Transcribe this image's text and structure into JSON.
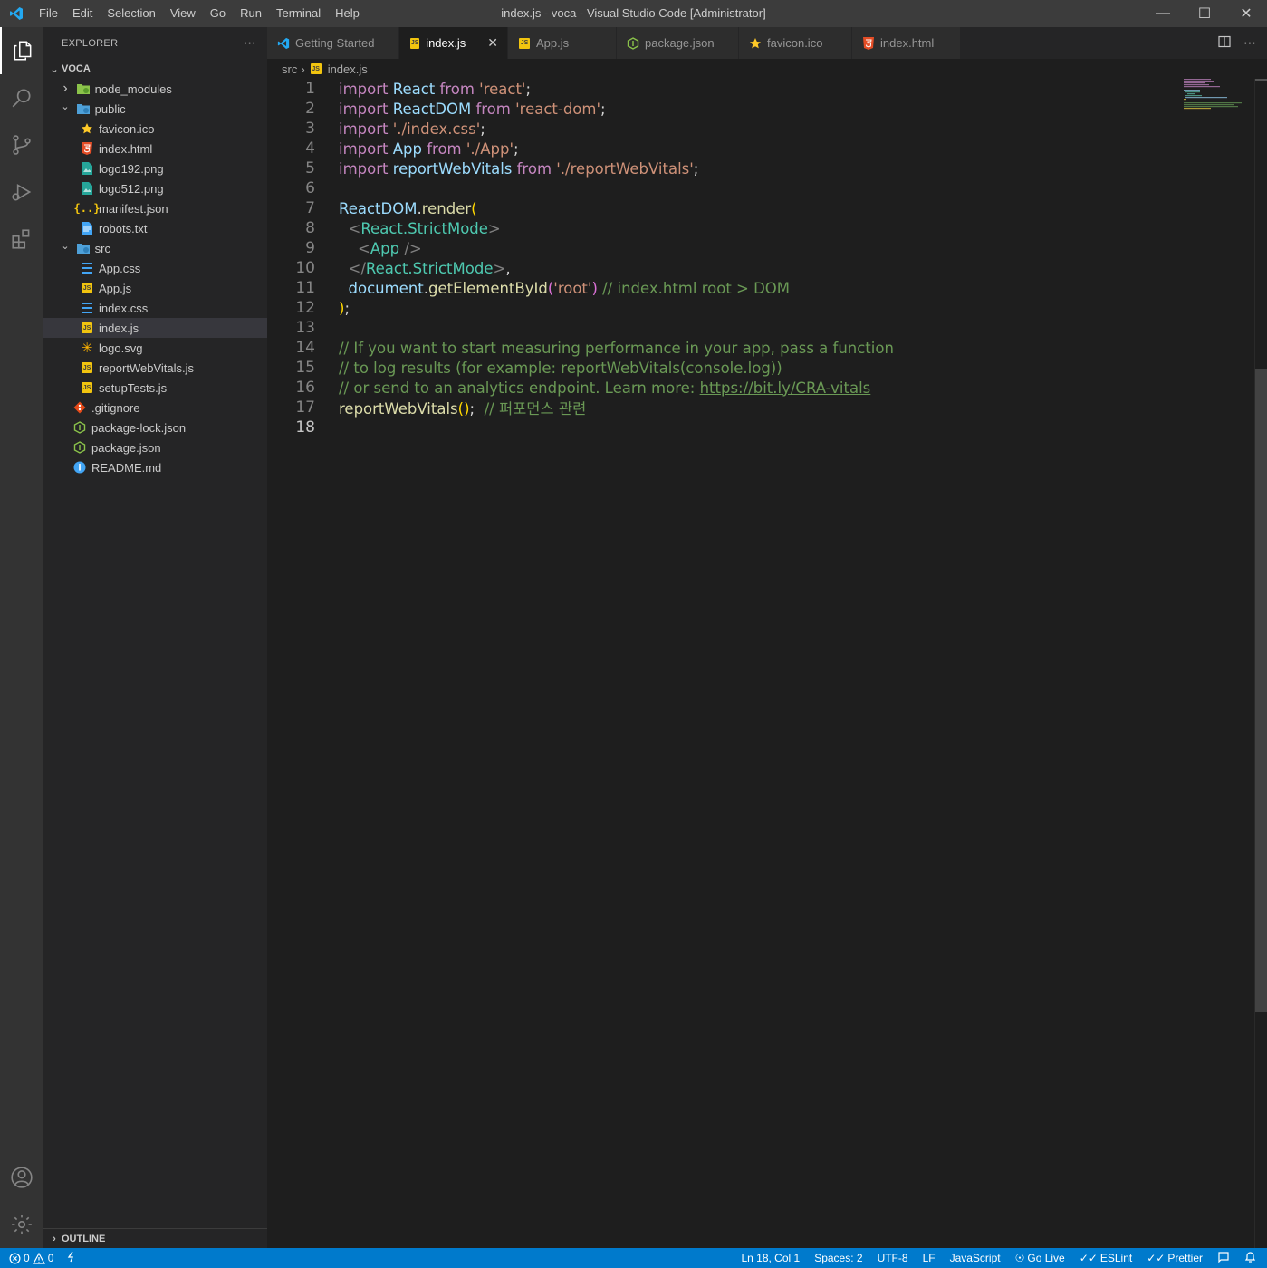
{
  "titlebar": {
    "menu": [
      "File",
      "Edit",
      "Selection",
      "View",
      "Go",
      "Run",
      "Terminal",
      "Help"
    ],
    "window_title": "index.js - voca - Visual Studio Code [Administrator]"
  },
  "explorer": {
    "header": "EXPLORER",
    "project": "VOCA",
    "items": [
      {
        "label": "node_modules",
        "kind": "folder-collapsed",
        "depth": 1
      },
      {
        "label": "public",
        "kind": "folder-open",
        "depth": 1
      },
      {
        "label": "favicon.ico",
        "kind": "favicon",
        "depth": 2
      },
      {
        "label": "index.html",
        "kind": "html",
        "depth": 2
      },
      {
        "label": "logo192.png",
        "kind": "image",
        "depth": 2
      },
      {
        "label": "logo512.png",
        "kind": "image",
        "depth": 2
      },
      {
        "label": "manifest.json",
        "kind": "json",
        "depth": 2
      },
      {
        "label": "robots.txt",
        "kind": "text",
        "depth": 2
      },
      {
        "label": "src",
        "kind": "folder-open",
        "depth": 1
      },
      {
        "label": "App.css",
        "kind": "css",
        "depth": 2
      },
      {
        "label": "App.js",
        "kind": "js",
        "depth": 2
      },
      {
        "label": "index.css",
        "kind": "css",
        "depth": 2
      },
      {
        "label": "index.js",
        "kind": "js",
        "depth": 2,
        "selected": true
      },
      {
        "label": "logo.svg",
        "kind": "svg",
        "depth": 2
      },
      {
        "label": "reportWebVitals.js",
        "kind": "js",
        "depth": 2
      },
      {
        "label": "setupTests.js",
        "kind": "js",
        "depth": 2
      },
      {
        "label": ".gitignore",
        "kind": "git",
        "depth": 1
      },
      {
        "label": "package-lock.json",
        "kind": "npm",
        "depth": 1
      },
      {
        "label": "package.json",
        "kind": "npm",
        "depth": 1
      },
      {
        "label": "README.md",
        "kind": "info",
        "depth": 1
      }
    ],
    "outline_label": "OUTLINE"
  },
  "tabs": [
    {
      "label": "Getting Started",
      "kind": "vscode"
    },
    {
      "label": "index.js",
      "kind": "js",
      "active": true
    },
    {
      "label": "App.js",
      "kind": "js"
    },
    {
      "label": "package.json",
      "kind": "npm"
    },
    {
      "label": "favicon.ico",
      "kind": "favicon"
    },
    {
      "label": "index.html",
      "kind": "html"
    }
  ],
  "breadcrumb": {
    "folder": "src",
    "file": "index.js"
  },
  "code": {
    "current_line": 18,
    "lines": [
      [
        [
          "kw",
          "import"
        ],
        [
          "punc",
          " "
        ],
        [
          "id",
          "React"
        ],
        [
          "punc",
          " "
        ],
        [
          "kw",
          "from"
        ],
        [
          "punc",
          " "
        ],
        [
          "str",
          "'react'"
        ],
        [
          "punc",
          ";"
        ]
      ],
      [
        [
          "kw",
          "import"
        ],
        [
          "punc",
          " "
        ],
        [
          "id",
          "ReactDOM"
        ],
        [
          "punc",
          " "
        ],
        [
          "kw",
          "from"
        ],
        [
          "punc",
          " "
        ],
        [
          "str",
          "'react-dom'"
        ],
        [
          "punc",
          ";"
        ]
      ],
      [
        [
          "kw",
          "import"
        ],
        [
          "punc",
          " "
        ],
        [
          "str",
          "'./index.css'"
        ],
        [
          "punc",
          ";"
        ]
      ],
      [
        [
          "kw",
          "import"
        ],
        [
          "punc",
          " "
        ],
        [
          "id",
          "App"
        ],
        [
          "punc",
          " "
        ],
        [
          "kw",
          "from"
        ],
        [
          "punc",
          " "
        ],
        [
          "str",
          "'./App'"
        ],
        [
          "punc",
          ";"
        ]
      ],
      [
        [
          "kw",
          "import"
        ],
        [
          "punc",
          " "
        ],
        [
          "id",
          "reportWebVitals"
        ],
        [
          "punc",
          " "
        ],
        [
          "kw",
          "from"
        ],
        [
          "punc",
          " "
        ],
        [
          "str",
          "'./reportWebVitals'"
        ],
        [
          "punc",
          ";"
        ]
      ],
      [],
      [
        [
          "id",
          "ReactDOM"
        ],
        [
          "punc",
          "."
        ],
        [
          "fn",
          "render"
        ],
        [
          "br1",
          "("
        ]
      ],
      [
        [
          "punc",
          "  "
        ],
        [
          "tag",
          "<"
        ],
        [
          "cls",
          "React.StrictMode"
        ],
        [
          "tag",
          ">"
        ]
      ],
      [
        [
          "punc",
          "    "
        ],
        [
          "tag",
          "<"
        ],
        [
          "cls",
          "App"
        ],
        [
          "punc",
          " "
        ],
        [
          "tag",
          "/>"
        ]
      ],
      [
        [
          "punc",
          "  "
        ],
        [
          "tag",
          "</"
        ],
        [
          "cls",
          "React.StrictMode"
        ],
        [
          "tag",
          ">"
        ],
        [
          "punc",
          ","
        ]
      ],
      [
        [
          "punc",
          "  "
        ],
        [
          "id",
          "document"
        ],
        [
          "punc",
          "."
        ],
        [
          "fn",
          "getElementById"
        ],
        [
          "br2",
          "("
        ],
        [
          "str",
          "'root'"
        ],
        [
          "br2",
          ")"
        ],
        [
          "punc",
          " "
        ],
        [
          "com",
          "// index.html root > DOM"
        ]
      ],
      [
        [
          "br1",
          ")"
        ],
        [
          "punc",
          ";"
        ]
      ],
      [],
      [
        [
          "com",
          "// If you want to start measuring performance in your app, pass a function"
        ]
      ],
      [
        [
          "com",
          "// to log results (for example: reportWebVitals(console.log))"
        ]
      ],
      [
        [
          "com",
          "// or send to an analytics endpoint. Learn more: "
        ],
        [
          "link",
          "https://bit.ly/CRA-vitals"
        ]
      ],
      [
        [
          "fn",
          "reportWebVitals"
        ],
        [
          "br1",
          "()"
        ],
        [
          "punc",
          ";  "
        ],
        [
          "com",
          "// 퍼포먼스 관련"
        ]
      ],
      []
    ]
  },
  "status": {
    "errors": "0",
    "warnings": "0",
    "position": "Ln 18, Col 1",
    "spaces": "Spaces: 2",
    "encoding": "UTF-8",
    "eol": "LF",
    "language": "JavaScript",
    "golive": "Go Live",
    "eslint": "ESLint",
    "prettier": "Prettier"
  }
}
